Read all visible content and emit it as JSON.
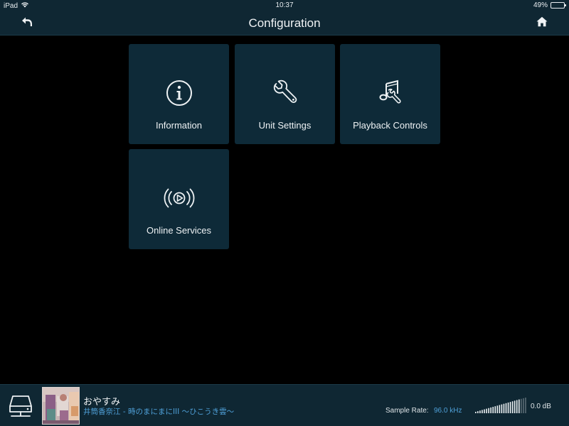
{
  "status_bar": {
    "device": "iPad",
    "time": "10:37",
    "battery_percent": "49%",
    "battery_level": 0.49,
    "wifi_icon": "wifi-icon"
  },
  "nav": {
    "title": "Configuration",
    "back_icon": "back-arrow-icon",
    "home_icon": "home-icon"
  },
  "tiles": [
    {
      "label": "Information",
      "icon": "info-icon"
    },
    {
      "label": "Unit Settings",
      "icon": "wrench-icon"
    },
    {
      "label": "Playback Controls",
      "icon": "music-settings-icon"
    },
    {
      "label": "Online Services",
      "icon": "streaming-icon"
    }
  ],
  "player": {
    "device_icon": "network-drive-icon",
    "track_title": "おやすみ",
    "track_subtitle": "井筒香奈江 - 時のまにまにIII 〜ひこうき雲〜",
    "sample_rate_label": "Sample Rate:",
    "sample_rate_value": "96.0 kHz",
    "volume_db": "0.0 dB",
    "volume_level": 0.85
  },
  "colors": {
    "bar_bg": "#0f2733",
    "tile_bg": "#0e2a38",
    "accent_blue": "#4fa0d8",
    "background": "#000000"
  }
}
